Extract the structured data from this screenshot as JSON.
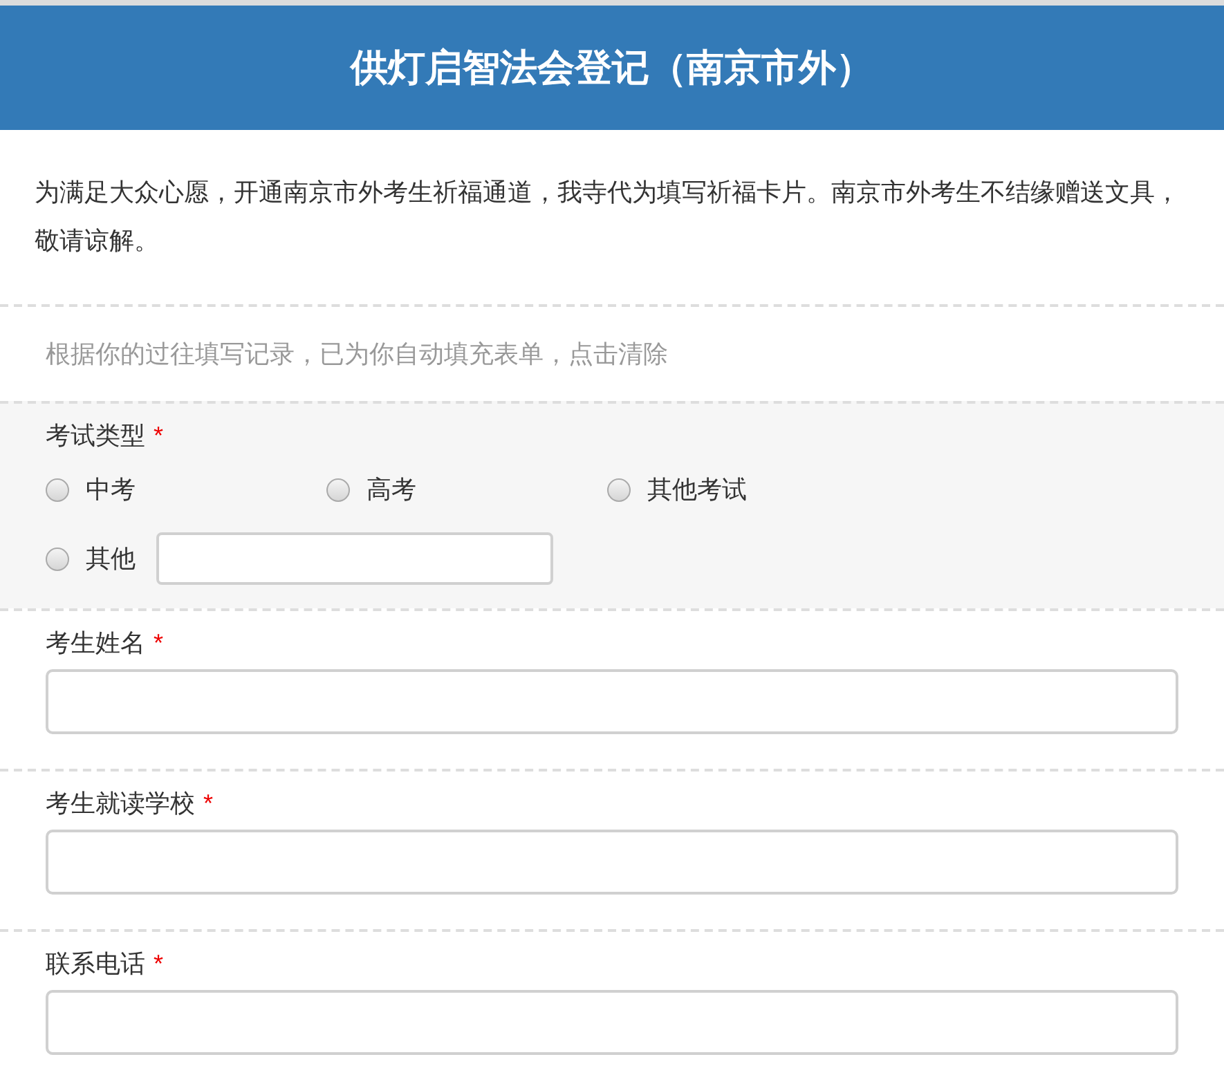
{
  "header": {
    "title": "供灯启智法会登记（南京市外）"
  },
  "intro": "为满足大众心愿，开通南京市外考生祈福通道，我寺代为填写祈福卡片。南京市外考生不结缘赠送文具，敬请谅解。",
  "autofill_notice": {
    "text": "根据你的过往填写记录，已为你自动填充表单，",
    "link": "点击清除"
  },
  "questions": [
    {
      "kind": "radio",
      "label": "考试类型",
      "required_mark": "*",
      "options": [
        {
          "label": "中考",
          "selected": false
        },
        {
          "label": "高考",
          "selected": false
        },
        {
          "label": "其他考试",
          "selected": false
        },
        {
          "label": "其他",
          "selected": false,
          "has_input": true
        }
      ]
    },
    {
      "kind": "text",
      "label": "考生姓名",
      "required_mark": "*"
    },
    {
      "kind": "text",
      "label": "考生就读学校",
      "required_mark": "*"
    },
    {
      "kind": "text",
      "label": "联系电话",
      "required_mark": "*"
    }
  ]
}
